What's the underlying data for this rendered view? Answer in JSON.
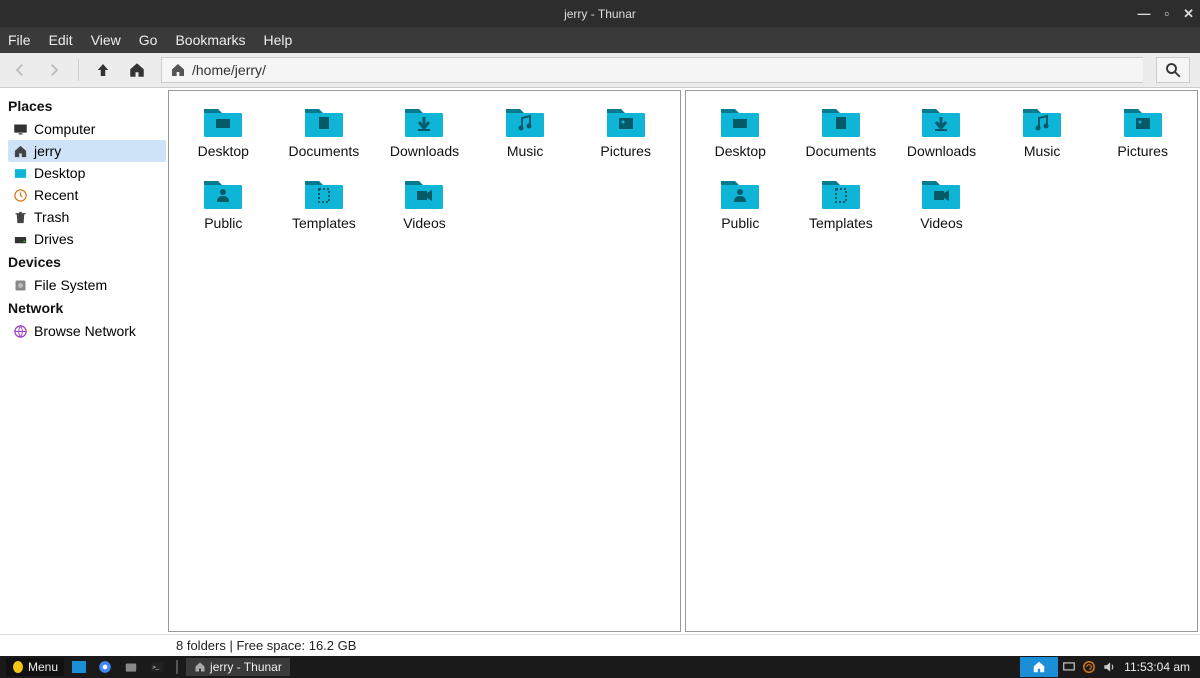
{
  "window": {
    "title": "jerry - Thunar"
  },
  "menubar": [
    "File",
    "Edit",
    "View",
    "Go",
    "Bookmarks",
    "Help"
  ],
  "pathbar": {
    "path": "/home/jerry/"
  },
  "sidebar": {
    "sections": [
      {
        "heading": "Places",
        "items": [
          {
            "label": "Computer",
            "icon": "monitor",
            "sel": false
          },
          {
            "label": "jerry",
            "icon": "home",
            "sel": true
          },
          {
            "label": "Desktop",
            "icon": "desktop",
            "sel": false
          },
          {
            "label": "Recent",
            "icon": "clock",
            "sel": false
          },
          {
            "label": "Trash",
            "icon": "trash",
            "sel": false
          },
          {
            "label": "Drives",
            "icon": "drive",
            "sel": false
          }
        ]
      },
      {
        "heading": "Devices",
        "items": [
          {
            "label": "File System",
            "icon": "disk",
            "sel": false
          }
        ]
      },
      {
        "heading": "Network",
        "items": [
          {
            "label": "Browse Network",
            "icon": "globe",
            "sel": false
          }
        ]
      }
    ]
  },
  "folders_left": [
    {
      "name": "Desktop",
      "glyph": "desk"
    },
    {
      "name": "Documents",
      "glyph": "doc"
    },
    {
      "name": "Downloads",
      "glyph": "down"
    },
    {
      "name": "Music",
      "glyph": "music"
    },
    {
      "name": "Pictures",
      "glyph": "pic"
    },
    {
      "name": "Public",
      "glyph": "pub"
    },
    {
      "name": "Templates",
      "glyph": "tmpl"
    },
    {
      "name": "Videos",
      "glyph": "vid"
    }
  ],
  "folders_right": [
    {
      "name": "Desktop",
      "glyph": "desk"
    },
    {
      "name": "Documents",
      "glyph": "doc"
    },
    {
      "name": "Downloads",
      "glyph": "down"
    },
    {
      "name": "Music",
      "glyph": "music"
    },
    {
      "name": "Pictures",
      "glyph": "pic"
    },
    {
      "name": "Public",
      "glyph": "pub"
    },
    {
      "name": "Templates",
      "glyph": "tmpl"
    },
    {
      "name": "Videos",
      "glyph": "vid"
    }
  ],
  "statusbar": {
    "text": "8 folders  |  Free space: 16.2 GB"
  },
  "taskbar": {
    "menu_label": "Menu",
    "active_task": "jerry - Thunar",
    "clock": "11:53:04 am"
  }
}
